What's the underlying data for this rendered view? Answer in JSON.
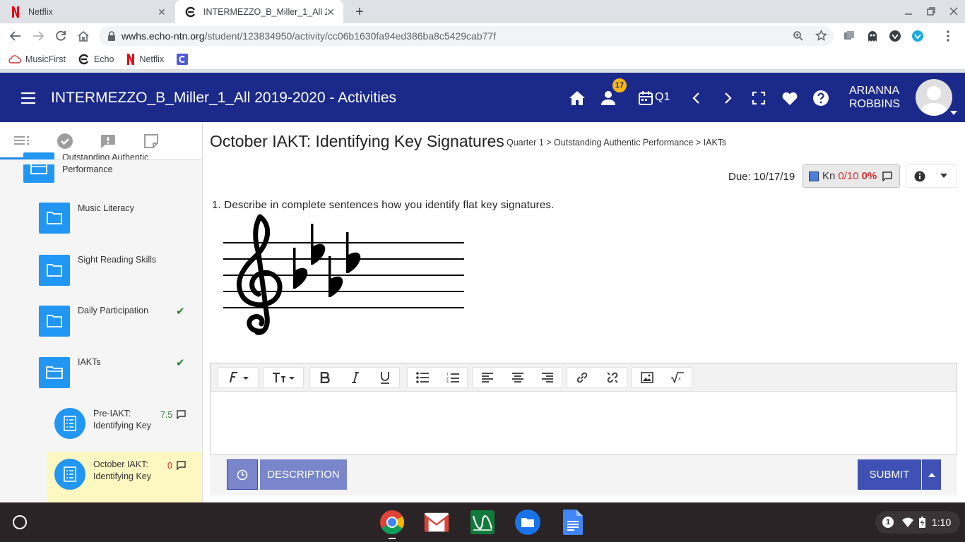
{
  "browser": {
    "tabs": [
      {
        "title": "Netflix",
        "active": false
      },
      {
        "title": "INTERMEZZO_B_Miller_1_All 201",
        "active": true
      }
    ],
    "new_tab": "+",
    "url_host": "wwhs.echo-ntn.org",
    "url_path": "/student/123834950/activity/cc06b1630fa94ed386ba8c5429cab77f",
    "bookmarks": [
      {
        "label": "MusicFirst"
      },
      {
        "label": "Echo"
      },
      {
        "label": "Netflix"
      }
    ]
  },
  "header": {
    "title": "INTERMEZZO_B_Miller_1_All 2019-2020 - Activities",
    "notification_count": "17",
    "period": "Q1",
    "user_first": "ARIANNA",
    "user_last": "ROBBINS"
  },
  "sidebar": {
    "items": [
      {
        "label": "Outstanding Authentic Performance",
        "checked": false
      },
      {
        "label": "Music Literacy",
        "checked": false
      },
      {
        "label": "Sight Reading Skills",
        "checked": false
      },
      {
        "label": "Daily Participation",
        "checked": true,
        "check_mark": "✔"
      },
      {
        "label": "IAKTs",
        "checked": true,
        "check_mark": "✔"
      }
    ],
    "activities": [
      {
        "label": "Pre-IAKT: Identifying Key",
        "score": "7.5"
      },
      {
        "label": "October IAKT: Identifying Key",
        "score": "0"
      }
    ]
  },
  "activity": {
    "title": "October IAKT: Identifying Key Signatures",
    "breadcrumb": "Quarter 1 > Outstanding Authentic Performance > IAKTs",
    "due": "Due: 10/17/19",
    "kn_label": "Kn",
    "kn_score": "0/10",
    "kn_percent": "0%",
    "question_number": "1.",
    "question_text": "Describe in complete sentences how you identify flat key signatures.",
    "description_label": "DESCRIPTION",
    "submit_label": "SUBMIT"
  },
  "shelf": {
    "notification": "1",
    "time": "1:10"
  },
  "colors": {
    "header_bg": "#1b2a8a",
    "folder_blue": "#2196f3",
    "active_row": "#fdf7c2",
    "submit": "#3f51b5",
    "description": "#7986cb"
  }
}
